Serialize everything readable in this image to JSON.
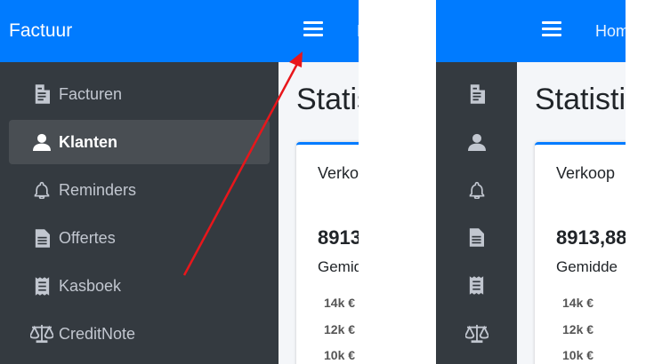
{
  "brand": "Factuur",
  "nav": {
    "home_label": "Home",
    "home_partial": "H"
  },
  "menu": [
    {
      "label": "Facturen",
      "icon": "invoice-icon",
      "active": false
    },
    {
      "label": "Klanten",
      "icon": "user-icon",
      "active": true
    },
    {
      "label": "Reminders",
      "icon": "bell-icon",
      "active": false
    },
    {
      "label": "Offertes",
      "icon": "document-icon",
      "active": false
    },
    {
      "label": "Kasboek",
      "icon": "receipt-icon",
      "active": false
    },
    {
      "label": "CreditNote",
      "icon": "balance-scale-icon",
      "active": false
    }
  ],
  "content": {
    "title": "Statistieken",
    "title_left": "Statis",
    "title_right": "Statisti",
    "card": {
      "title_left": "Verko",
      "title_right": "Verkoop",
      "value_left": "8913",
      "value_right": "8913,88",
      "sub_left": "Gemid",
      "sub_right": "Gemidde",
      "ticks": [
        "14k €",
        "12k €",
        "10k €"
      ]
    }
  },
  "colors": {
    "primary": "#007bff",
    "sidebar": "#343a40",
    "active_item": "#494e53",
    "annotation_arrow": "#e8161b"
  }
}
